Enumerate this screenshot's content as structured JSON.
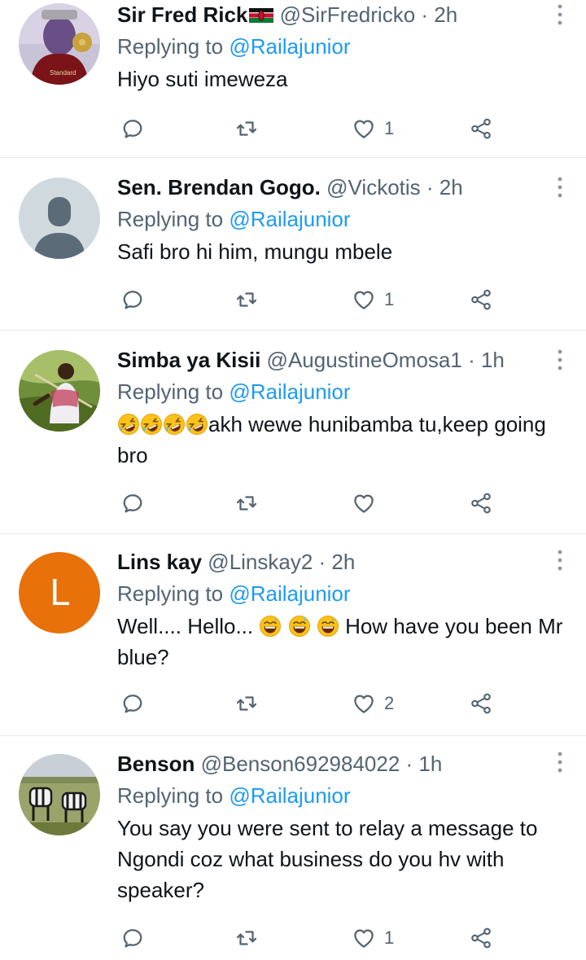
{
  "tweets": [
    {
      "name": "Sir Fred Rick",
      "handle": "@SirFredricko",
      "time": "· 2h",
      "replying_prefix": "Replying to",
      "replying_to": "@Railajunior",
      "text": "Hiyo suti imeweza",
      "likes": "1",
      "avatar": "thanos-gauntlet-photo"
    },
    {
      "name": "Sen. Brendan Gogo.",
      "handle": "@Vickotis",
      "time": "· 2h",
      "replying_prefix": "Replying to",
      "replying_to": "@Railajunior",
      "text": "Safi bro hi him, mungu mbele",
      "likes": "1",
      "avatar": "default-profile-silhouette"
    },
    {
      "name": "Simba ya Kisii",
      "handle": "@AugustineOmosa1",
      "time": "· 1h",
      "replying_prefix": "Replying to",
      "replying_to": "@Railajunior",
      "text": "akh wewe hunibamba tu,keep going bro",
      "likes": "",
      "avatar": "man-outdoors-photo"
    },
    {
      "name": "Lins kay",
      "handle": "@Linskay2",
      "time": "· 2h",
      "replying_prefix": "Replying to",
      "replying_to": "@Railajunior",
      "text_part1": "Well.... Hello...",
      "text_part2": "How have you been Mr blue?",
      "likes": "2",
      "avatar_letter": "L",
      "avatar_color": "#e8710a"
    },
    {
      "name": "Benson",
      "handle": "@Benson692984022",
      "time": "· 1h",
      "replying_prefix": "Replying to",
      "replying_to": "@Railajunior",
      "text": "You say you were sent to relay a message to Ngondi coz what business do you hv with speaker?",
      "likes": "1",
      "avatar": "zebras-grassland-photo"
    }
  ],
  "colors": {
    "link": "#1d9bf0",
    "secondary_text": "#536471",
    "divider": "#e6e9ec"
  },
  "icons": [
    "reply-icon",
    "retweet-icon",
    "like-icon",
    "share-icon",
    "more-icon",
    "kenya-flag-emoji",
    "rolling-laughing-emoji",
    "grinning-sweat-emoji"
  ]
}
